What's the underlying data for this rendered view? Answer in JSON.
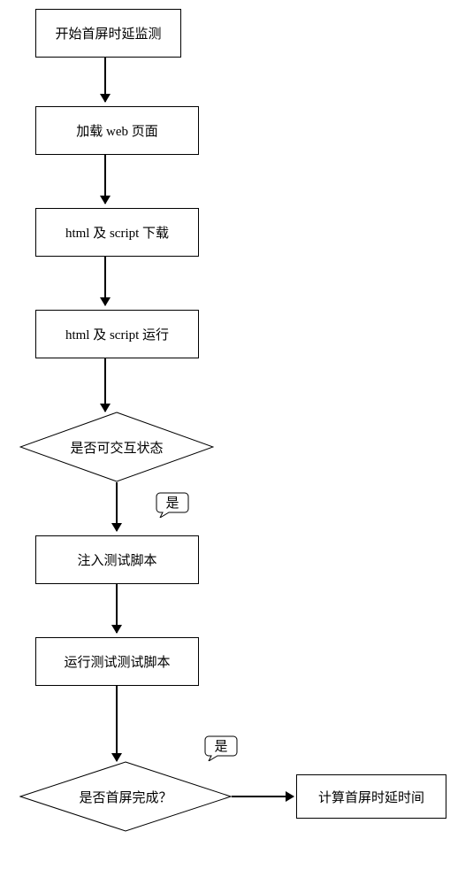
{
  "flow": {
    "steps": [
      {
        "id": "start",
        "type": "process",
        "label": "开始首屏时延监测"
      },
      {
        "id": "load",
        "type": "process",
        "label": "加载 web 页面"
      },
      {
        "id": "download",
        "type": "process",
        "label": "html 及 script 下载"
      },
      {
        "id": "run",
        "type": "process",
        "label": "html 及 script 运行"
      },
      {
        "id": "interact",
        "type": "decision",
        "label": "是否可交互状态"
      },
      {
        "id": "inject",
        "type": "process",
        "label": "注入测试脚本"
      },
      {
        "id": "runtest",
        "type": "process",
        "label": "运行测试测试脚本"
      },
      {
        "id": "done",
        "type": "decision",
        "label": "是否首屏完成？"
      },
      {
        "id": "calc",
        "type": "process",
        "label": "计算首屏时延时间"
      }
    ],
    "edges": [
      {
        "from": "start",
        "to": "load",
        "label": ""
      },
      {
        "from": "load",
        "to": "download",
        "label": ""
      },
      {
        "from": "download",
        "to": "run",
        "label": ""
      },
      {
        "from": "run",
        "to": "interact",
        "label": ""
      },
      {
        "from": "interact",
        "to": "inject",
        "label": "是"
      },
      {
        "from": "inject",
        "to": "runtest",
        "label": ""
      },
      {
        "from": "runtest",
        "to": "done",
        "label": ""
      },
      {
        "from": "done",
        "to": "calc",
        "label": "是"
      }
    ],
    "annotations": {
      "yes1": "是",
      "yes2": "是"
    }
  }
}
